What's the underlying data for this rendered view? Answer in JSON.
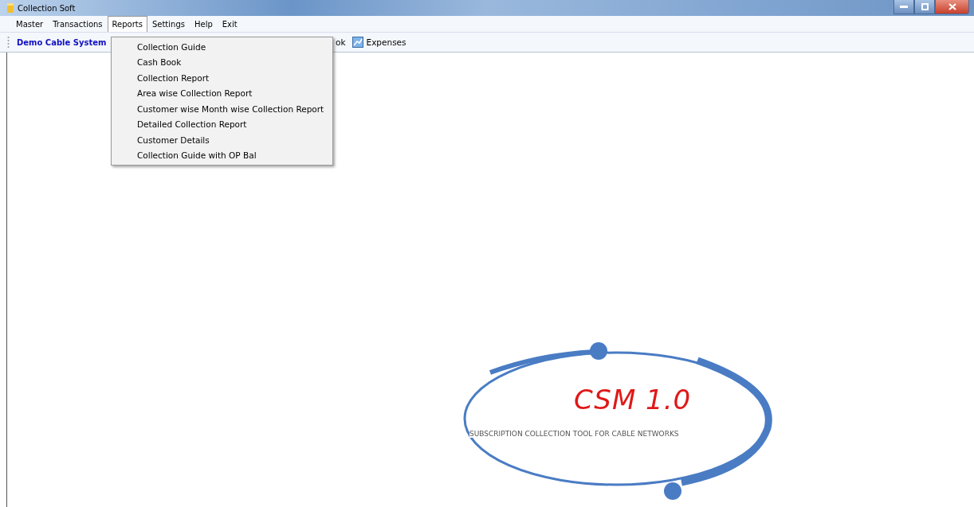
{
  "window": {
    "title": "Collection Soft"
  },
  "menu": [
    {
      "label": "Master",
      "selected": false
    },
    {
      "label": "Transactions",
      "selected": false
    },
    {
      "label": "Reports",
      "selected": true
    },
    {
      "label": "Settings",
      "selected": false
    },
    {
      "label": "Help",
      "selected": false
    },
    {
      "label": "Exit",
      "selected": false
    }
  ],
  "toolbar": {
    "company": "Demo Cable System",
    "items": [
      {
        "label": "ok",
        "kind": "text"
      },
      {
        "label": "Expenses",
        "kind": "icon"
      }
    ]
  },
  "dropdown": [
    "Collection Guide",
    "Cash Book",
    "Collection Report",
    "Area wise Collection Report",
    "Customer wise Month wise Collection Report",
    "Detailed Collection Report",
    "Customer Details",
    "Collection Guide with OP Bal"
  ],
  "logo": {
    "title": "CSM 1.0",
    "subtitle": "SUBSCRIPTION COLLECTION TOOL FOR CABLE NETWORKS"
  }
}
